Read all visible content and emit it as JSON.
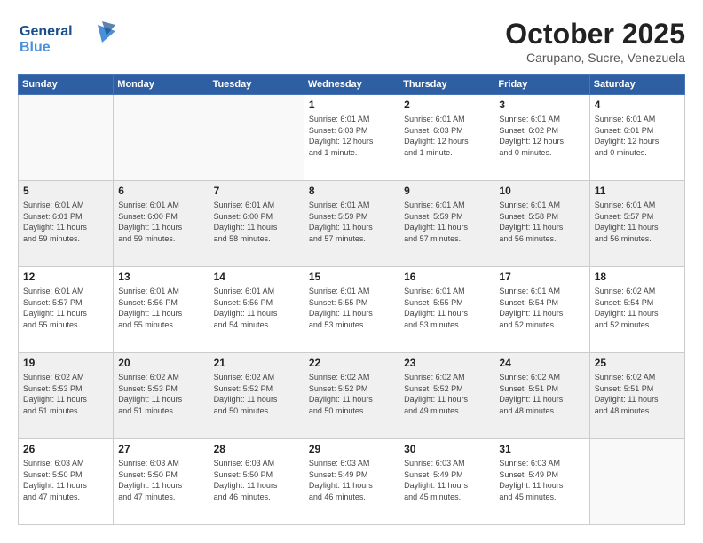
{
  "logo": {
    "line1": "General",
    "line2": "Blue"
  },
  "header": {
    "month": "October 2025",
    "location": "Carupano, Sucre, Venezuela"
  },
  "weekdays": [
    "Sunday",
    "Monday",
    "Tuesday",
    "Wednesday",
    "Thursday",
    "Friday",
    "Saturday"
  ],
  "weeks": [
    [
      {
        "day": "",
        "info": ""
      },
      {
        "day": "",
        "info": ""
      },
      {
        "day": "",
        "info": ""
      },
      {
        "day": "1",
        "info": "Sunrise: 6:01 AM\nSunset: 6:03 PM\nDaylight: 12 hours\nand 1 minute."
      },
      {
        "day": "2",
        "info": "Sunrise: 6:01 AM\nSunset: 6:03 PM\nDaylight: 12 hours\nand 1 minute."
      },
      {
        "day": "3",
        "info": "Sunrise: 6:01 AM\nSunset: 6:02 PM\nDaylight: 12 hours\nand 0 minutes."
      },
      {
        "day": "4",
        "info": "Sunrise: 6:01 AM\nSunset: 6:01 PM\nDaylight: 12 hours\nand 0 minutes."
      }
    ],
    [
      {
        "day": "5",
        "info": "Sunrise: 6:01 AM\nSunset: 6:01 PM\nDaylight: 11 hours\nand 59 minutes."
      },
      {
        "day": "6",
        "info": "Sunrise: 6:01 AM\nSunset: 6:00 PM\nDaylight: 11 hours\nand 59 minutes."
      },
      {
        "day": "7",
        "info": "Sunrise: 6:01 AM\nSunset: 6:00 PM\nDaylight: 11 hours\nand 58 minutes."
      },
      {
        "day": "8",
        "info": "Sunrise: 6:01 AM\nSunset: 5:59 PM\nDaylight: 11 hours\nand 57 minutes."
      },
      {
        "day": "9",
        "info": "Sunrise: 6:01 AM\nSunset: 5:59 PM\nDaylight: 11 hours\nand 57 minutes."
      },
      {
        "day": "10",
        "info": "Sunrise: 6:01 AM\nSunset: 5:58 PM\nDaylight: 11 hours\nand 56 minutes."
      },
      {
        "day": "11",
        "info": "Sunrise: 6:01 AM\nSunset: 5:57 PM\nDaylight: 11 hours\nand 56 minutes."
      }
    ],
    [
      {
        "day": "12",
        "info": "Sunrise: 6:01 AM\nSunset: 5:57 PM\nDaylight: 11 hours\nand 55 minutes."
      },
      {
        "day": "13",
        "info": "Sunrise: 6:01 AM\nSunset: 5:56 PM\nDaylight: 11 hours\nand 55 minutes."
      },
      {
        "day": "14",
        "info": "Sunrise: 6:01 AM\nSunset: 5:56 PM\nDaylight: 11 hours\nand 54 minutes."
      },
      {
        "day": "15",
        "info": "Sunrise: 6:01 AM\nSunset: 5:55 PM\nDaylight: 11 hours\nand 53 minutes."
      },
      {
        "day": "16",
        "info": "Sunrise: 6:01 AM\nSunset: 5:55 PM\nDaylight: 11 hours\nand 53 minutes."
      },
      {
        "day": "17",
        "info": "Sunrise: 6:01 AM\nSunset: 5:54 PM\nDaylight: 11 hours\nand 52 minutes."
      },
      {
        "day": "18",
        "info": "Sunrise: 6:02 AM\nSunset: 5:54 PM\nDaylight: 11 hours\nand 52 minutes."
      }
    ],
    [
      {
        "day": "19",
        "info": "Sunrise: 6:02 AM\nSunset: 5:53 PM\nDaylight: 11 hours\nand 51 minutes."
      },
      {
        "day": "20",
        "info": "Sunrise: 6:02 AM\nSunset: 5:53 PM\nDaylight: 11 hours\nand 51 minutes."
      },
      {
        "day": "21",
        "info": "Sunrise: 6:02 AM\nSunset: 5:52 PM\nDaylight: 11 hours\nand 50 minutes."
      },
      {
        "day": "22",
        "info": "Sunrise: 6:02 AM\nSunset: 5:52 PM\nDaylight: 11 hours\nand 50 minutes."
      },
      {
        "day": "23",
        "info": "Sunrise: 6:02 AM\nSunset: 5:52 PM\nDaylight: 11 hours\nand 49 minutes."
      },
      {
        "day": "24",
        "info": "Sunrise: 6:02 AM\nSunset: 5:51 PM\nDaylight: 11 hours\nand 48 minutes."
      },
      {
        "day": "25",
        "info": "Sunrise: 6:02 AM\nSunset: 5:51 PM\nDaylight: 11 hours\nand 48 minutes."
      }
    ],
    [
      {
        "day": "26",
        "info": "Sunrise: 6:03 AM\nSunset: 5:50 PM\nDaylight: 11 hours\nand 47 minutes."
      },
      {
        "day": "27",
        "info": "Sunrise: 6:03 AM\nSunset: 5:50 PM\nDaylight: 11 hours\nand 47 minutes."
      },
      {
        "day": "28",
        "info": "Sunrise: 6:03 AM\nSunset: 5:50 PM\nDaylight: 11 hours\nand 46 minutes."
      },
      {
        "day": "29",
        "info": "Sunrise: 6:03 AM\nSunset: 5:49 PM\nDaylight: 11 hours\nand 46 minutes."
      },
      {
        "day": "30",
        "info": "Sunrise: 6:03 AM\nSunset: 5:49 PM\nDaylight: 11 hours\nand 45 minutes."
      },
      {
        "day": "31",
        "info": "Sunrise: 6:03 AM\nSunset: 5:49 PM\nDaylight: 11 hours\nand 45 minutes."
      },
      {
        "day": "",
        "info": ""
      }
    ]
  ]
}
